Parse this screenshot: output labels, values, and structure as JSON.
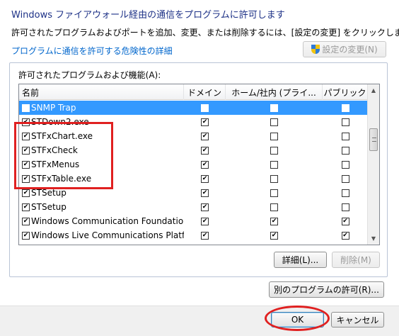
{
  "window": {
    "title": "Windows ファイアウォール経由の通信をプログラムに許可します",
    "description": "許可されたプログラムおよびポートを追加、変更、または削除するには、[設定の変更] をクリックします。",
    "risk_link": "プログラムに通信を許可する危険性の詳細",
    "change_settings_label": "設定の変更(N)"
  },
  "group": {
    "label": "許可されたプログラムおよび機能(A):"
  },
  "table": {
    "columns": [
      "名前",
      "ドメイン",
      "ホーム/社内 (プライ...",
      "パブリック"
    ],
    "rows": [
      {
        "name": "SNMP Trap",
        "enabled": false,
        "domain": false,
        "home": false,
        "public": false,
        "selected": true
      },
      {
        "name": "STDown2.exe",
        "enabled": true,
        "domain": true,
        "home": false,
        "public": false,
        "selected": false
      },
      {
        "name": "STFxChart.exe",
        "enabled": true,
        "domain": true,
        "home": false,
        "public": false,
        "selected": false
      },
      {
        "name": "STFxCheck",
        "enabled": true,
        "domain": true,
        "home": false,
        "public": false,
        "selected": false
      },
      {
        "name": "STFxMenus",
        "enabled": true,
        "domain": true,
        "home": false,
        "public": false,
        "selected": false
      },
      {
        "name": "STFxTable.exe",
        "enabled": true,
        "domain": true,
        "home": false,
        "public": false,
        "selected": false
      },
      {
        "name": "STSetup",
        "enabled": true,
        "domain": true,
        "home": false,
        "public": false,
        "selected": false
      },
      {
        "name": "STSetup",
        "enabled": true,
        "domain": true,
        "home": false,
        "public": false,
        "selected": false
      },
      {
        "name": "Windows Communication Foundation",
        "enabled": true,
        "domain": true,
        "home": true,
        "public": true,
        "selected": false
      },
      {
        "name": "Windows Live Communications Platfo...",
        "enabled": true,
        "domain": true,
        "home": true,
        "public": true,
        "selected": false
      }
    ]
  },
  "buttons": {
    "details": "詳細(L)...",
    "remove": "削除(M)",
    "allow_another": "別のプログラムの許可(R)...",
    "ok": "OK",
    "cancel": "キャンセル"
  },
  "colors": {
    "title": "#1e3287",
    "link": "#0066cc",
    "selection": "#3399ff",
    "annotation": "#e02020"
  }
}
